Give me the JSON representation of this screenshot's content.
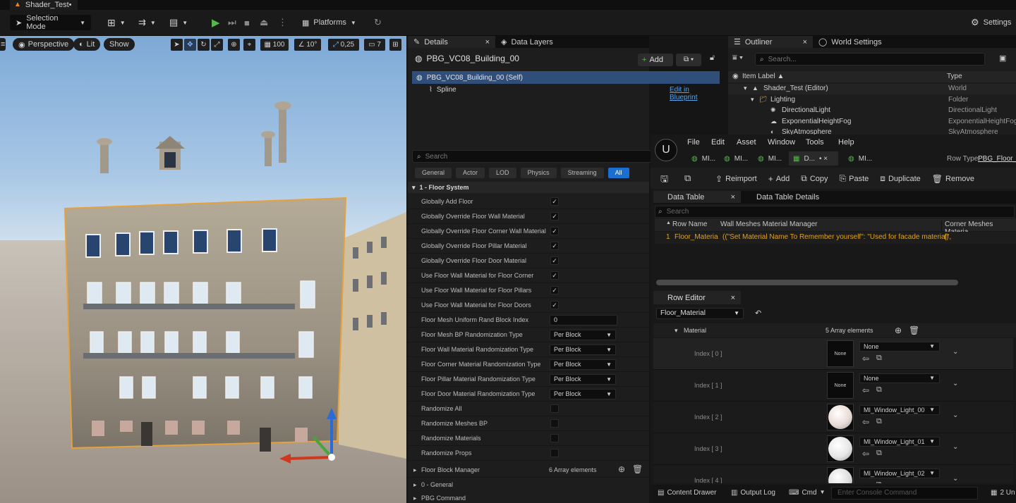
{
  "window": {
    "title": "Shader_Test•"
  },
  "toolbar": {
    "selection_mode": "Selection Mode",
    "platforms": "Platforms",
    "settings": "Settings"
  },
  "viewport": {
    "perspective": "Perspective",
    "lit": "Lit",
    "show": "Show",
    "grid_value": "100",
    "angle_value": "10°",
    "scale_value": "0,25",
    "camera_speed": "7"
  },
  "details": {
    "tab": "Details",
    "tab2": "Data Layers",
    "actor_name": "PBG_VC08_Building_00",
    "add_label": "Add",
    "self_item": "PBG_VC08_Building_00 (Self)",
    "spline_item": "Spline",
    "edit_blueprint": "Edit in Blueprint",
    "search_placeholder": "Search",
    "filters": [
      "General",
      "Actor",
      "LOD",
      "Physics",
      "Streaming",
      "All"
    ],
    "section": "1 - Floor System",
    "props": [
      {
        "label": "Globally Add Floor",
        "kind": "check",
        "value": "✓"
      },
      {
        "label": "Globally Override Floor Wall Material",
        "kind": "check",
        "value": "✓"
      },
      {
        "label": "Globally Override Floor Corner Wall Material",
        "kind": "check",
        "value": "✓"
      },
      {
        "label": "Globally Override Floor Pillar Material",
        "kind": "check",
        "value": "✓"
      },
      {
        "label": "Globally Override Floor Door Material",
        "kind": "check",
        "value": "✓"
      },
      {
        "label": "Use Floor Wall Material for Floor Corner",
        "kind": "check",
        "value": "✓"
      },
      {
        "label": "Use Floor Wall Material for Floor Pillars",
        "kind": "check",
        "value": "✓"
      },
      {
        "label": "Use Floor Wall Material for Floor Doors",
        "kind": "check",
        "value": "✓"
      },
      {
        "label": "Floor Mesh Uniform Rand Block Index",
        "kind": "num",
        "value": "0"
      },
      {
        "label": "Floor Mesh BP Randomization Type",
        "kind": "combo",
        "value": "Per Block"
      },
      {
        "label": "Floor Wall Material Randomization Type",
        "kind": "combo",
        "value": "Per Block"
      },
      {
        "label": "Floor Corner Material Randomization Type",
        "kind": "combo",
        "value": "Per Block"
      },
      {
        "label": "Floor Pillar Material Randomization Type",
        "kind": "combo",
        "value": "Per Block"
      },
      {
        "label": "Floor Door Material Randomization Type",
        "kind": "combo",
        "value": "Per Block"
      },
      {
        "label": "Randomize All",
        "kind": "check",
        "value": ""
      },
      {
        "label": "Randomize Meshes BP",
        "kind": "check",
        "value": ""
      },
      {
        "label": "Randomize Materials",
        "kind": "check",
        "value": ""
      },
      {
        "label": "Randomize Props",
        "kind": "check",
        "value": ""
      }
    ],
    "block_manager": "Floor Block Manager",
    "block_count": "6 Array elements",
    "general": "0 - General",
    "pbg_command": "PBG Command"
  },
  "outliner": {
    "tab": "Outliner",
    "tab2": "World Settings",
    "search_placeholder": "Search...",
    "col_label": "Item Label ▲",
    "col_type": "Type",
    "rows": [
      {
        "label": "Shader_Test (Editor)",
        "type": "World"
      },
      {
        "label": "Lighting",
        "type": "Folder"
      },
      {
        "label": "DirectionalLight",
        "type": "DirectionalLight"
      },
      {
        "label": "ExponentialHeightFog",
        "type": "ExponentialHeightFog"
      },
      {
        "label": "SkyAtmosphere",
        "type": "SkyAtmosphere"
      }
    ]
  },
  "datatable": {
    "menus": [
      "File",
      "Edit",
      "Asset",
      "Window",
      "Tools",
      "Help"
    ],
    "doc_tabs": [
      "MI...",
      "MI...",
      "MI...",
      "D...",
      "MI..."
    ],
    "row_type_label": "Row Type:",
    "row_type_value": "PBG_Floor_M",
    "actions": [
      "Reimport",
      "Add",
      "Copy",
      "Paste",
      "Duplicate",
      "Remove"
    ],
    "tab_table": "Data Table",
    "tab_details": "Data Table Details",
    "search_placeholder": "Search",
    "col_row": "Row Name",
    "col_wall": "Wall Meshes Material Manager",
    "col_corner": "Corner Meshes Materia",
    "row_index": "1",
    "row_name": "Floor_Materia",
    "row_value": "((\"Set Material Name To Remember yourself\": \"Used for facade material\",",
    "row_corner": "()",
    "row_editor": "Row Editor",
    "row_select": "Floor_Material",
    "material_label": "Material",
    "material_count": "5 Array elements",
    "entries": [
      {
        "index": "Index [ 0 ]",
        "value": "None",
        "thumb": "None"
      },
      {
        "index": "Index [ 1 ]",
        "value": "None",
        "thumb": "None"
      },
      {
        "index": "Index [ 2 ]",
        "value": "MI_Window_Light_00",
        "thumb": ""
      },
      {
        "index": "Index [ 3 ]",
        "value": "MI_Window_Light_01",
        "thumb": ""
      },
      {
        "index": "Index [ 4 ]",
        "value": "MI_Window_Light_02",
        "thumb": ""
      }
    ]
  },
  "statusbar": {
    "content_drawer": "Content Drawer",
    "output_log": "Output Log",
    "cmd": "Cmd",
    "console_placeholder": "Enter Console Command",
    "unsaved": "2 Un"
  }
}
